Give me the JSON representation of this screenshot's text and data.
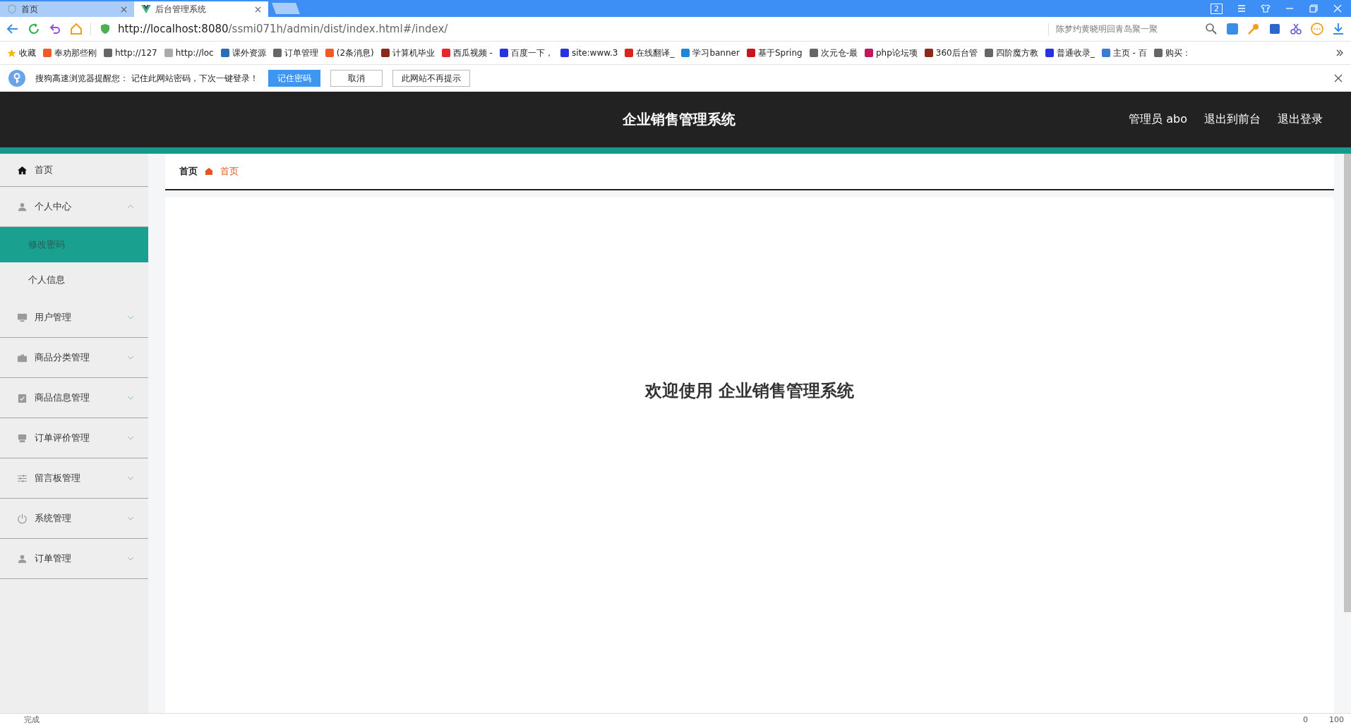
{
  "browser": {
    "tabs": [
      {
        "title": "首页",
        "selected": false
      },
      {
        "title": "后台管理系统",
        "selected": true
      }
    ],
    "tab_count": "2",
    "url_host": "http://localhost:8080",
    "url_path": "/ssmi071h/admin/dist/index.html#/index/",
    "search_hint": "陈梦约黄晓明回青岛聚一聚",
    "favorites": "收藏",
    "bookmarks": [
      {
        "label": "奉劝那些刚",
        "color": "#f05a28"
      },
      {
        "label": "http://127",
        "color": "#666666"
      },
      {
        "label": "http://loc",
        "color": "#aaaaaa"
      },
      {
        "label": "课外资源",
        "color": "#2a6fb5"
      },
      {
        "label": "订单管理",
        "color": "#666666"
      },
      {
        "label": "(2条消息)",
        "color": "#f05a28"
      },
      {
        "label": "计算机毕业",
        "color": "#8b2a1a"
      },
      {
        "label": "西瓜视频 -",
        "color": "#e8262d"
      },
      {
        "label": "百度一下，",
        "color": "#2932e1"
      },
      {
        "label": "site:www.3",
        "color": "#2932e1"
      },
      {
        "label": "在线翻译_",
        "color": "#d9241c"
      },
      {
        "label": "学习banner",
        "color": "#1e88d8"
      },
      {
        "label": "基于Spring",
        "color": "#c8161d"
      },
      {
        "label": "次元仓-最",
        "color": "#666666"
      },
      {
        "label": "php论坛项",
        "color": "#c2185b"
      },
      {
        "label": "360后台管",
        "color": "#8b2a1a"
      },
      {
        "label": "四阶魔方教",
        "color": "#666666"
      },
      {
        "label": "普通收录_",
        "color": "#2932e1"
      },
      {
        "label": "主页 - 百",
        "color": "#3a7bd5"
      },
      {
        "label": "购买：",
        "color": "#666666"
      }
    ],
    "notice": {
      "text": "搜狗高速浏览器提醒您： 记住此网站密码，下次一键登录！",
      "buttons": [
        {
          "label": "记住密码",
          "primary": true
        },
        {
          "label": "取消",
          "primary": false
        },
        {
          "label": "此网站不再提示",
          "primary": false
        }
      ]
    },
    "status": {
      "text": "完成",
      "count": "0",
      "zoom": "100"
    }
  },
  "header": {
    "title": "企业销售管理系统",
    "links": [
      "管理员 abo",
      "退出到前台",
      "退出登录"
    ]
  },
  "sidebar": {
    "items": [
      {
        "label": "首页"
      },
      {
        "label": "个人中心",
        "expanded": true,
        "children": [
          {
            "label": "修改密码",
            "selected": true
          },
          {
            "label": "个人信息",
            "selected": false
          }
        ]
      },
      {
        "label": "用户管理",
        "expanded": false
      },
      {
        "label": "商品分类管理",
        "expanded": false
      },
      {
        "label": "商品信息管理",
        "expanded": false
      },
      {
        "label": "订单评价管理",
        "expanded": false
      },
      {
        "label": "留言板管理",
        "expanded": false
      },
      {
        "label": "系统管理",
        "expanded": false
      },
      {
        "label": "订单管理",
        "expanded": false
      }
    ]
  },
  "breadcrumb": [
    "首页",
    "首页"
  ],
  "welcome": "欢迎使用 企业销售管理系统"
}
